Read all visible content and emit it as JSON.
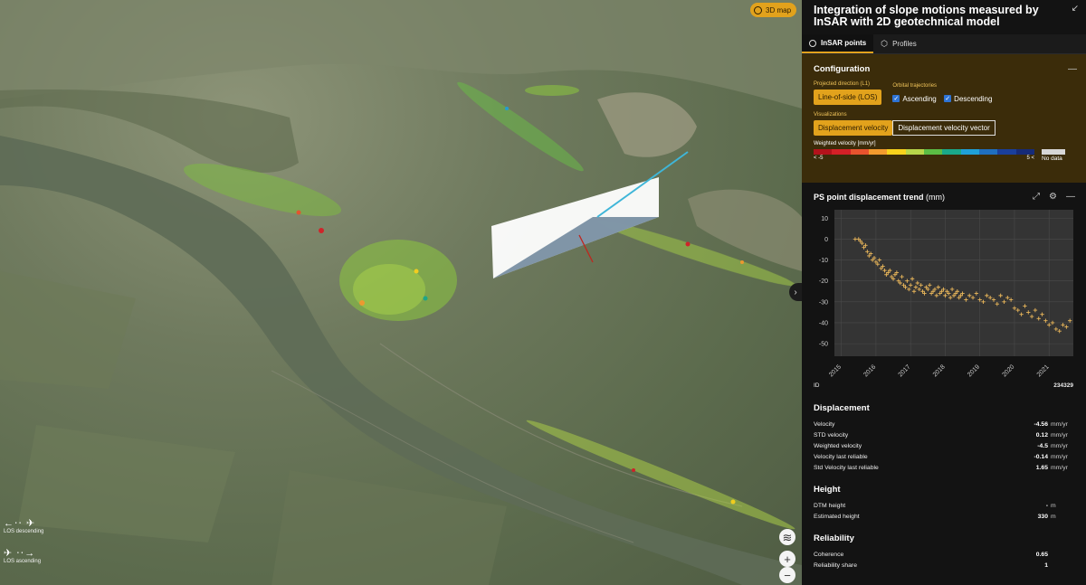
{
  "map": {
    "mode_badge": "3D map",
    "legend": [
      {
        "label": "LOS descending",
        "arrows": "←⋅⋅ ✈"
      },
      {
        "label": "LOS ascending",
        "arrows": "✈ ⋅⋅→"
      }
    ],
    "controls": {
      "layers": "≋",
      "zoom_in": "+",
      "zoom_out": "−",
      "collapse": "›"
    }
  },
  "panel": {
    "title": "Integration of slope motions measured by InSAR with 2D geotechnical model",
    "collapse_icon": "↙",
    "tabs": [
      {
        "label": "InSAR points",
        "active": true,
        "icon": "radio-icon"
      },
      {
        "label": "Profiles",
        "active": false,
        "icon": "hexagon-icon"
      }
    ],
    "configuration": {
      "title": "Configuration",
      "projected_label": "Projected direction (L1)",
      "projected_value": "Line-of-side (LOS)",
      "orbital_label": "Orbital trajectories",
      "ascending": "Ascending",
      "descending": "Descending",
      "visualizations_label": "Visualizations",
      "vis_active": "Displacement velocity",
      "vis_other": "Displacement velocity vector",
      "velocity_label": "Weighted velocity [mm/yr]",
      "min_label": "< -5",
      "max_label": "5 <",
      "nodata_label": "No data",
      "colors": [
        "#b3121b",
        "#d42027",
        "#e8532e",
        "#f39b2e",
        "#f8d21c",
        "#b8d64a",
        "#5bbd45",
        "#1aa98a",
        "#1fa0d8",
        "#1f6fc0",
        "#1a3f9c",
        "#162b78"
      ]
    },
    "trend": {
      "title": "PS point displacement trend",
      "unit": "(mm)",
      "chart_data": {
        "type": "scatter",
        "title": "",
        "xlabel": "",
        "ylabel": "",
        "x_ticks": [
          "2015",
          "2016",
          "2017",
          "2018",
          "2019",
          "2020",
          "2021"
        ],
        "y_ticks": [
          10,
          0,
          -10,
          -20,
          -30,
          -40,
          -50
        ],
        "xlim": [
          2014.8,
          2021.7
        ],
        "ylim": [
          -56,
          14
        ],
        "grid": true,
        "series": [
          {
            "color": "#e9b65a",
            "x": [
              2015.4,
              2015.5,
              2015.55,
              2015.6,
              2015.65,
              2015.7,
              2015.75,
              2015.8,
              2015.85,
              2015.9,
              2015.95,
              2016.0,
              2016.05,
              2016.1,
              2016.15,
              2016.2,
              2016.25,
              2016.3,
              2016.35,
              2016.4,
              2016.45,
              2016.5,
              2016.55,
              2016.6,
              2016.65,
              2016.7,
              2016.75,
              2016.8,
              2016.85,
              2016.9,
              2016.95,
              2017.0,
              2017.05,
              2017.1,
              2017.15,
              2017.2,
              2017.25,
              2017.3,
              2017.35,
              2017.4,
              2017.45,
              2017.5,
              2017.55,
              2017.6,
              2017.65,
              2017.7,
              2017.75,
              2017.8,
              2017.85,
              2017.9,
              2017.95,
              2018.0,
              2018.05,
              2018.1,
              2018.15,
              2018.2,
              2018.25,
              2018.3,
              2018.35,
              2018.4,
              2018.45,
              2018.5,
              2018.6,
              2018.7,
              2018.8,
              2018.9,
              2019.0,
              2019.1,
              2019.2,
              2019.3,
              2019.4,
              2019.5,
              2019.6,
              2019.7,
              2019.8,
              2019.9,
              2020.0,
              2020.1,
              2020.2,
              2020.3,
              2020.4,
              2020.5,
              2020.6,
              2020.7,
              2020.8,
              2020.9,
              2021.0,
              2021.1,
              2021.2,
              2021.3,
              2021.4,
              2021.5,
              2021.6
            ],
            "y": [
              0,
              0,
              -1,
              -2,
              -4,
              -3,
              -6,
              -8,
              -7,
              -10,
              -9,
              -11,
              -12,
              -10,
              -14,
              -13,
              -15,
              -17,
              -16,
              -15,
              -18,
              -19,
              -17,
              -16,
              -20,
              -21,
              -18,
              -22,
              -23,
              -20,
              -24,
              -22,
              -19,
              -25,
              -23,
              -21,
              -24,
              -22,
              -25,
              -26,
              -23,
              -24,
              -22,
              -26,
              -25,
              -24,
              -27,
              -23,
              -26,
              -25,
              -24,
              -27,
              -25,
              -26,
              -28,
              -24,
              -27,
              -26,
              -25,
              -28,
              -27,
              -26,
              -29,
              -27,
              -28,
              -26,
              -29,
              -30,
              -27,
              -28,
              -29,
              -31,
              -27,
              -30,
              -28,
              -29,
              -33,
              -34,
              -36,
              -32,
              -35,
              -37,
              -34,
              -38,
              -36,
              -39,
              -41,
              -40,
              -43,
              -44,
              -41,
              -42,
              -39
            ]
          }
        ]
      }
    },
    "id": {
      "label": "ID",
      "value": "234329"
    },
    "displacement": {
      "title": "Displacement",
      "rows": [
        {
          "label": "Velocity",
          "value": "-4.56",
          "unit": "mm/yr"
        },
        {
          "label": "STD velocity",
          "value": "0.12",
          "unit": "mm/yr"
        },
        {
          "label": "Weighted velocity",
          "value": "-4.5",
          "unit": "mm/yr"
        },
        {
          "label": "Velocity last reliable",
          "value": "-0.14",
          "unit": "mm/yr"
        },
        {
          "label": "Std Velocity last reliable",
          "value": "1.65",
          "unit": "mm/yr"
        }
      ]
    },
    "height": {
      "title": "Height",
      "rows": [
        {
          "label": "DTM height",
          "value": "-",
          "unit": "m"
        },
        {
          "label": "Estimated height",
          "value": "330",
          "unit": "m"
        }
      ]
    },
    "reliability": {
      "title": "Reliability",
      "rows": [
        {
          "label": "Coherence",
          "value": "0.65",
          "unit": ""
        },
        {
          "label": "Reliability share",
          "value": "1",
          "unit": ""
        }
      ]
    }
  }
}
